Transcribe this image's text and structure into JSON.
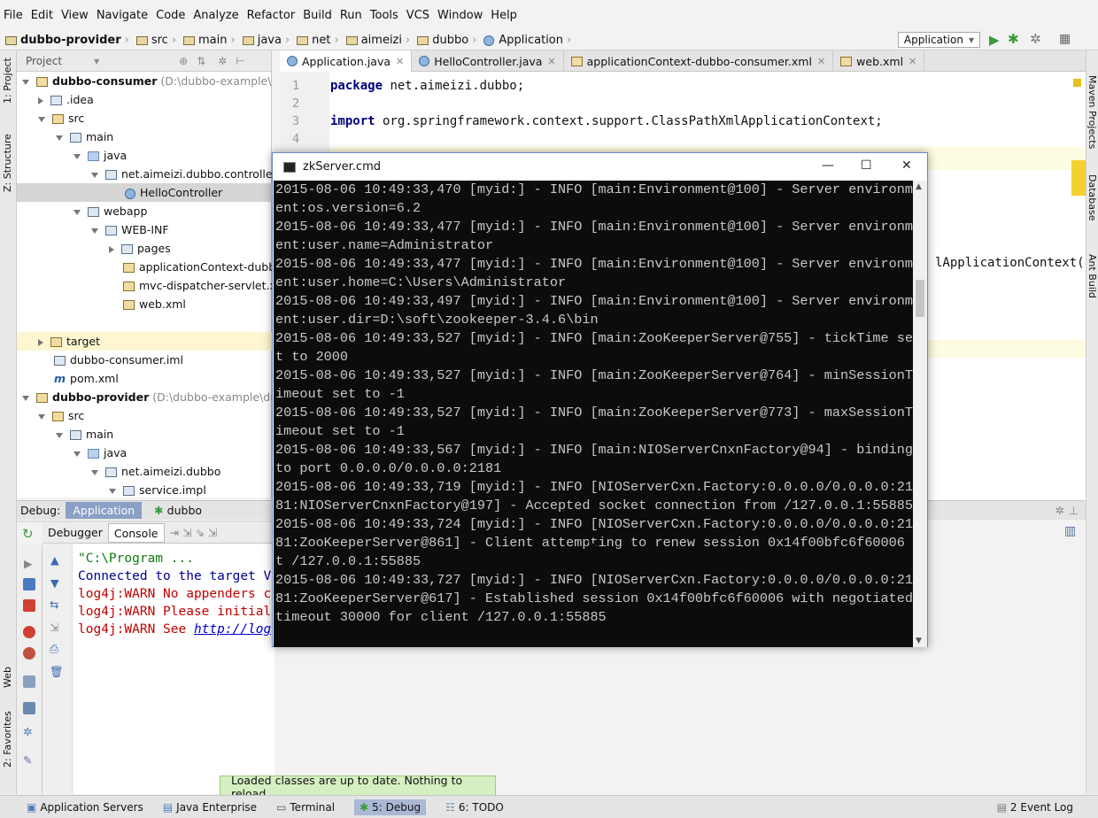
{
  "menu": [
    "File",
    "Edit",
    "View",
    "Navigate",
    "Code",
    "Analyze",
    "Refactor",
    "Build",
    "Run",
    "Tools",
    "VCS",
    "Window",
    "Help"
  ],
  "breadcrumb": [
    "dubbo-provider",
    "src",
    "main",
    "java",
    "net",
    "aimeizi",
    "dubbo",
    "Application"
  ],
  "run_config": "Application",
  "left_strip": {
    "project": "1: Project",
    "structure": "Z: Structure",
    "web": "Web",
    "favorites": "2: Favorites"
  },
  "right_strip": {
    "maven": "Maven Projects",
    "database": "Database",
    "ant": "Ant Build"
  },
  "project_panel": {
    "title": "Project",
    "tree": [
      {
        "label": "dubbo-consumer",
        "extra": "(D:\\dubbo-example\\du",
        "bold": true
      },
      {
        "label": ".idea"
      },
      {
        "label": "src"
      },
      {
        "label": "main"
      },
      {
        "label": "java"
      },
      {
        "label": "net.aimeizi.dubbo.controller"
      },
      {
        "label": "HelloController"
      },
      {
        "label": "webapp"
      },
      {
        "label": "WEB-INF"
      },
      {
        "label": "pages"
      },
      {
        "label": "applicationContext-dubb"
      },
      {
        "label": "mvc-dispatcher-servlet.x"
      },
      {
        "label": "web.xml"
      },
      {
        "label": "target"
      },
      {
        "label": "dubbo-consumer.iml"
      },
      {
        "label": "pom.xml"
      },
      {
        "label": "dubbo-provider",
        "extra": "(D:\\dubbo-example\\dub",
        "bold": true
      },
      {
        "label": "src"
      },
      {
        "label": "main"
      },
      {
        "label": "java"
      },
      {
        "label": "net.aimeizi.dubbo"
      },
      {
        "label": "service.impl"
      }
    ]
  },
  "editor_tabs": [
    {
      "label": "Application.java",
      "active": true
    },
    {
      "label": "HelloController.java"
    },
    {
      "label": "applicationContext-dubbo-consumer.xml"
    },
    {
      "label": "web.xml"
    }
  ],
  "editor": {
    "line_numbers": [
      "1",
      "2",
      "3",
      "4"
    ],
    "line1_kw": "package",
    "line1_rest": " net.aimeizi.dubbo;",
    "line3_kw": "import",
    "line3_rest": " org.springframework.context.support.ClassPathXmlApplicationContext;",
    "peek_text": "lApplicationContext("
  },
  "debug": {
    "label": "Debug:",
    "tabs": [
      "Application",
      "dubbo"
    ],
    "subtabs": [
      "Debugger",
      "Console"
    ],
    "console_lines": [
      {
        "text": "\"C:\\Program ...",
        "color": "#117a11"
      },
      {
        "text": "Connected to the target V",
        "color": "#00008b"
      },
      {
        "text": "log4j:WARN No appenders c",
        "color": "#c00000"
      },
      {
        "text": "log4j:WARN Please initial",
        "color": "#c00000"
      },
      {
        "text": "log4j:WARN See ",
        "color": "#c00000",
        "link": "http://log"
      }
    ]
  },
  "toast": "Loaded classes are up to date. Nothing to reload.",
  "status_tabs": [
    "Application Servers",
    "Java Enterprise",
    "Terminal",
    "5: Debug",
    "6: TODO",
    "2 Event Log"
  ],
  "cmd_window": {
    "title": "zkServer.cmd",
    "lines": [
      "2015-08-06 10:49:33,470 [myid:] - INFO  [main:Environment@100] - Server environm",
      "ent:os.version=6.2",
      "2015-08-06 10:49:33,477 [myid:] - INFO  [main:Environment@100] - Server environm",
      "ent:user.name=Administrator",
      "2015-08-06 10:49:33,477 [myid:] - INFO  [main:Environment@100] - Server environm",
      "ent:user.home=C:\\Users\\Administrator",
      "2015-08-06 10:49:33,497 [myid:] - INFO  [main:Environment@100] - Server environm",
      "ent:user.dir=D:\\soft\\zookeeper-3.4.6\\bin",
      "2015-08-06 10:49:33,527 [myid:] - INFO  [main:ZooKeeperServer@755] - tickTime se",
      "t to 2000",
      "2015-08-06 10:49:33,527 [myid:] - INFO  [main:ZooKeeperServer@764] - minSessionT",
      "imeout set to -1",
      "2015-08-06 10:49:33,527 [myid:] - INFO  [main:ZooKeeperServer@773] - maxSessionT",
      "imeout set to -1",
      "2015-08-06 10:49:33,567 [myid:] - INFO  [main:NIOServerCnxnFactory@94] - binding",
      " to port 0.0.0.0/0.0.0.0:2181",
      "2015-08-06 10:49:33,719 [myid:] - INFO  [NIOServerCxn.Factory:0.0.0.0/0.0.0.0:21",
      "81:NIOServerCnxnFactory@197] - Accepted socket connection from /127.0.0.1:55885",
      "2015-08-06 10:49:33,724 [myid:] - INFO  [NIOServerCxn.Factory:0.0.0.0/0.0.0.0:21",
      "81:ZooKeeperServer@861] - Client attempting to renew session 0x14f00bfc6f60006 a",
      "t /127.0.0.1:55885",
      "2015-08-06 10:49:33,727 [myid:] - INFO  [NIOServerCxn.Factory:0.0.0.0/0.0.0.0:21",
      "81:ZooKeeperServer@617] - Established session 0x14f00bfc6f60006 with negotiated",
      "timeout 30000 for client /127.0.0.1:55885"
    ]
  }
}
